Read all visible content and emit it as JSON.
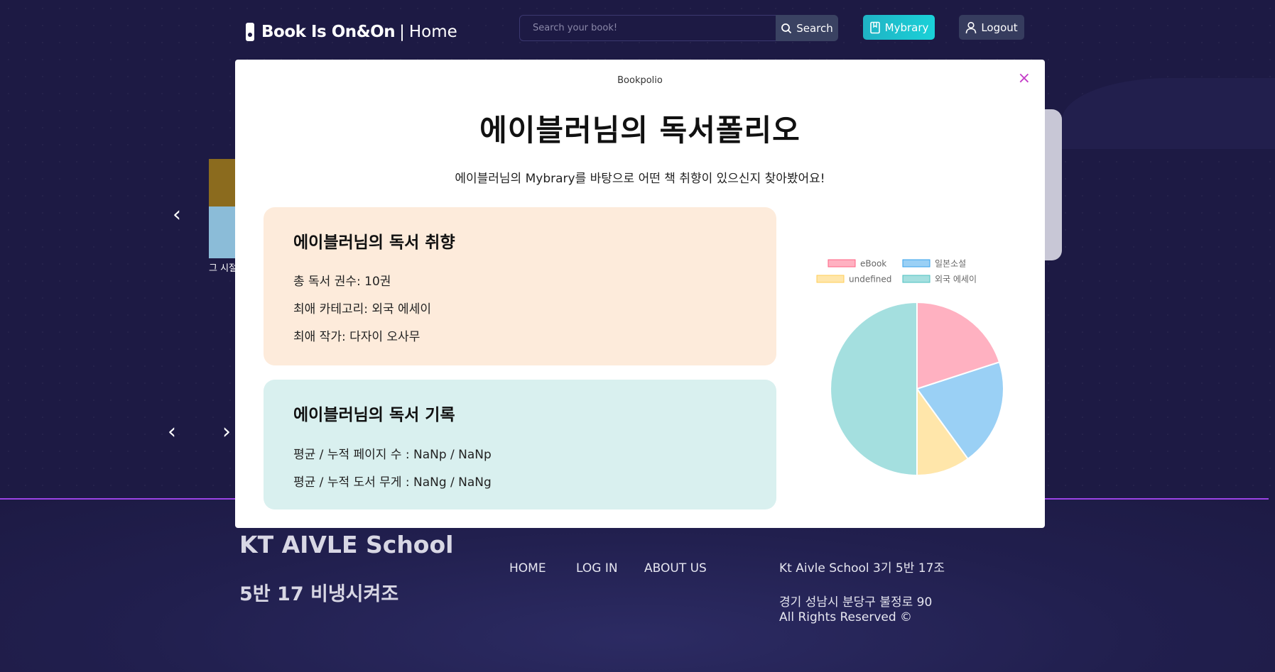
{
  "header": {
    "brand_title": "Book Is On&On",
    "brand_separator": "|",
    "brand_page": "Home",
    "search_placeholder": "Search your book!",
    "search_label": "Search",
    "mybrary_label": "Mybrary",
    "logout_label": "Logout"
  },
  "background": {
    "book_caption": "그 시절",
    "arrow_left": "‹",
    "arrow_right": "›"
  },
  "modal": {
    "label": "Bookpolio",
    "close": "×",
    "title": "에이블러님의 독서폴리오",
    "description": "에이블러님의 Mybrary를 바탕으로 어떤 책 취향이 있으신지 찾아봤어요!",
    "taste": {
      "heading": "에이블러님의 독서 취향",
      "total": "총 독서 권수: 10권",
      "category": "최애 카테고리: 외국 에세이",
      "author": "최애 작가: 다자이 오사무"
    },
    "record": {
      "heading": "에이블러님의 독서 기록",
      "pages": "평균 / 누적 페이지 수 : NaNp / NaNp",
      "weight": "평균 / 누적 도서 무게 : NaNg / NaNg"
    }
  },
  "chart_data": {
    "type": "pie",
    "labels": [
      "eBook",
      "일본소설",
      "undefined",
      "외국 에세이"
    ],
    "values": [
      2,
      2,
      1,
      5
    ],
    "colors": [
      "#ffb1c1",
      "#9ad0f5",
      "#ffe6aa",
      "#a4dfdf"
    ],
    "borders": [
      "#ff6384",
      "#36a2eb",
      "#ffcd56",
      "#4bc0c0"
    ],
    "legend_position": "top"
  },
  "footer": {
    "title": "KT AIVLE School",
    "subtitle": "5반 17 비냉시켜조",
    "links": [
      "HOME",
      "LOG IN",
      "ABOUT US"
    ],
    "team": "Kt Aivle School 3기 5반 17조",
    "address": "경기 성남시 분당구 불정로 90",
    "rights": "All Rights Reserved ©"
  }
}
